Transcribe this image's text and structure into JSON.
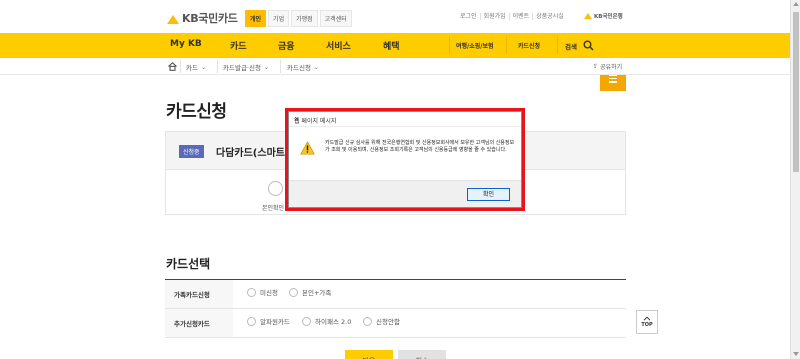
{
  "header": {
    "logo_text": "KB국민카드",
    "segments": [
      "개인",
      "기업",
      "가맹점",
      "고객센터"
    ],
    "utility_links": [
      "로그인",
      "회원가입",
      "이벤트",
      "상품공시실"
    ],
    "bank_label": "KB국민은행"
  },
  "nav": {
    "items": [
      "My KB",
      "카드",
      "금융",
      "서비스",
      "혜택"
    ],
    "sub_items": [
      "여행/쇼핑/보험",
      "카드신청"
    ],
    "search_label": "검색"
  },
  "breadcrumb": {
    "items": [
      "카드",
      "카드발급·신청",
      "카드신청"
    ],
    "share_label": "공유하기"
  },
  "page": {
    "title": "카드신청",
    "badge": "신청중",
    "card_name": "다담카드(스마트 C",
    "step_label_left": "본인확인",
    "step_label_right": "",
    "section_title": "카드선택"
  },
  "options": [
    {
      "label": "가족카드신청",
      "choices": [
        "미신청",
        "본인+가족"
      ]
    },
    {
      "label": "추가신청카드",
      "choices": [
        "알파원카드",
        "하이패스 2.0",
        "신청안함"
      ]
    }
  ],
  "buttons": {
    "top": "TOP",
    "primary": "다음",
    "secondary": "취소"
  },
  "dialog": {
    "title": "웹 페이지 메시지",
    "message": "카드발급 신규 심사를 위해 전국은행연합회 및 신용정보회사에서 보유한 고객님의 신용정보가 조회 및 이용되며, 신용정보 조회기록은 고객님의 신용등급에 영향을 줄 수 있습니다.",
    "ok_label": "확인"
  },
  "colors": {
    "brand_yellow": "#ffcc00",
    "highlight_red": "#e8141c",
    "badge_blue": "#5b6ab8"
  }
}
